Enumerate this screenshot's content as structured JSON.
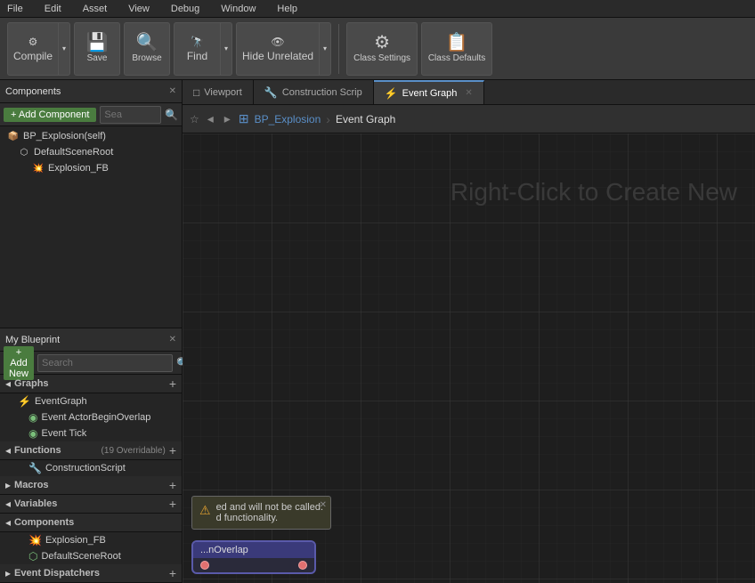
{
  "menu": {
    "items": [
      "File",
      "Edit",
      "Asset",
      "View",
      "Debug",
      "Window",
      "Help"
    ]
  },
  "toolbar": {
    "compile_label": "Compile",
    "save_label": "Save",
    "browse_label": "Browse",
    "find_label": "Find",
    "hide_unrelated_label": "Hide Unrelated",
    "class_settings_label": "Class Settings",
    "class_defaults_label": "Class Defaults"
  },
  "components_panel": {
    "title": "Components",
    "search_placeholder": "Sea",
    "add_component_label": "+ Add Component",
    "items": [
      {
        "label": "BP_Explosion(self)",
        "indent": 0,
        "icon": "📦"
      },
      {
        "label": "DefaultSceneRoot",
        "indent": 1,
        "icon": "⬡"
      },
      {
        "label": "Explosion_FB",
        "indent": 2,
        "icon": "💥"
      }
    ]
  },
  "my_blueprint": {
    "title": "My Blueprint",
    "add_new_label": "+ Add New",
    "search_placeholder": "Search",
    "sections": {
      "graphs": {
        "title": "Graphs",
        "items": [
          {
            "label": "EventGraph",
            "indent": 1,
            "icon": "⚡"
          },
          {
            "label": "Event ActorBeginOverlap",
            "indent": 2,
            "icon": "◉"
          },
          {
            "label": "Event Tick",
            "indent": 2,
            "icon": "◉"
          }
        ]
      },
      "functions": {
        "title": "Functions",
        "subtitle": "(19 Overridable)",
        "items": [
          {
            "label": "ConstructionScript",
            "indent": 2,
            "icon": "🔧"
          }
        ]
      },
      "macros": {
        "title": "Macros",
        "items": []
      },
      "variables": {
        "title": "Variables",
        "items": []
      },
      "components": {
        "title": "Components",
        "items": [
          {
            "label": "Explosion_FB",
            "indent": 2,
            "icon": "💥"
          },
          {
            "label": "DefaultSceneRoot",
            "indent": 2,
            "icon": "⬡"
          }
        ]
      },
      "event_dispatchers": {
        "title": "Event Dispatchers",
        "items": []
      }
    }
  },
  "tabs": [
    {
      "label": "Viewport",
      "icon": "□",
      "active": false
    },
    {
      "label": "Construction Scrip",
      "icon": "🔧",
      "active": false
    },
    {
      "label": "Event Graph",
      "icon": "⚡",
      "active": true,
      "closeable": true
    }
  ],
  "breadcrumb": {
    "back_title": "Back",
    "forward_title": "Forward",
    "blueprint_label": "BP_Explosion",
    "current_label": "Event Graph"
  },
  "graph": {
    "hint_text": "Right-Click to Create New"
  },
  "warning_popup": {
    "text": "ed and will not be called.\nd functionality."
  },
  "node": {
    "header": "...nOverlap",
    "pin_label": ""
  }
}
